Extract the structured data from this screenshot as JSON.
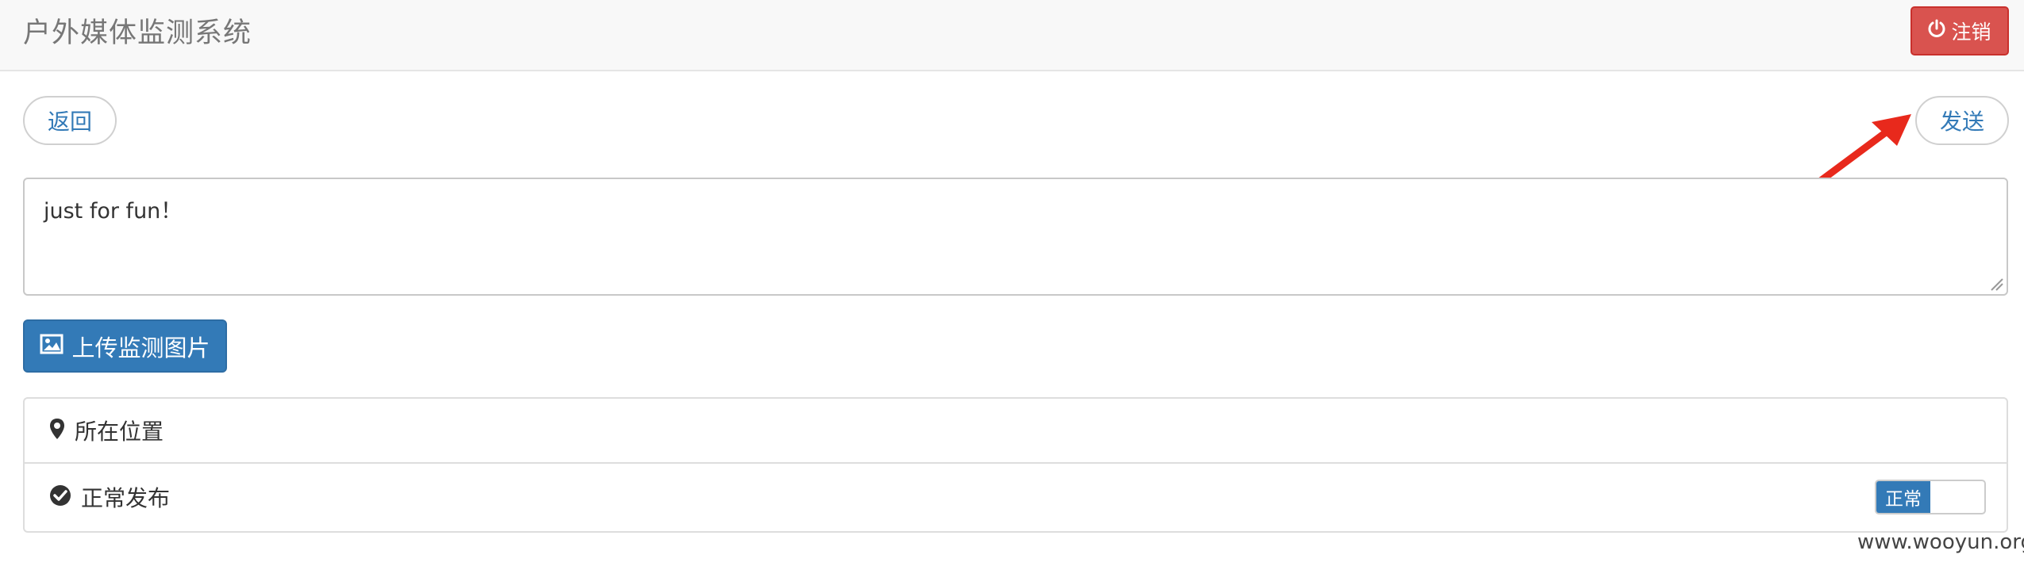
{
  "header": {
    "title": "户外媒体监测系统",
    "logout_label": "注销",
    "logout_icon": "power-icon"
  },
  "toolbar": {
    "back_label": "返回",
    "send_label": "发送"
  },
  "message": {
    "value": "just for fun！"
  },
  "upload": {
    "label": "上传监测图片",
    "icon": "image-icon"
  },
  "panel": {
    "location_label": "所在位置",
    "location_icon": "map-marker-icon",
    "publish_label": "正常发布",
    "publish_icon": "check-circle-icon",
    "publish_switch": {
      "on_label": "正常",
      "state": "on"
    }
  },
  "watermark": "www.wooyun.org",
  "colors": {
    "danger": "#d9534f",
    "primary": "#337ab7",
    "annotation_arrow": "#e8291c"
  }
}
